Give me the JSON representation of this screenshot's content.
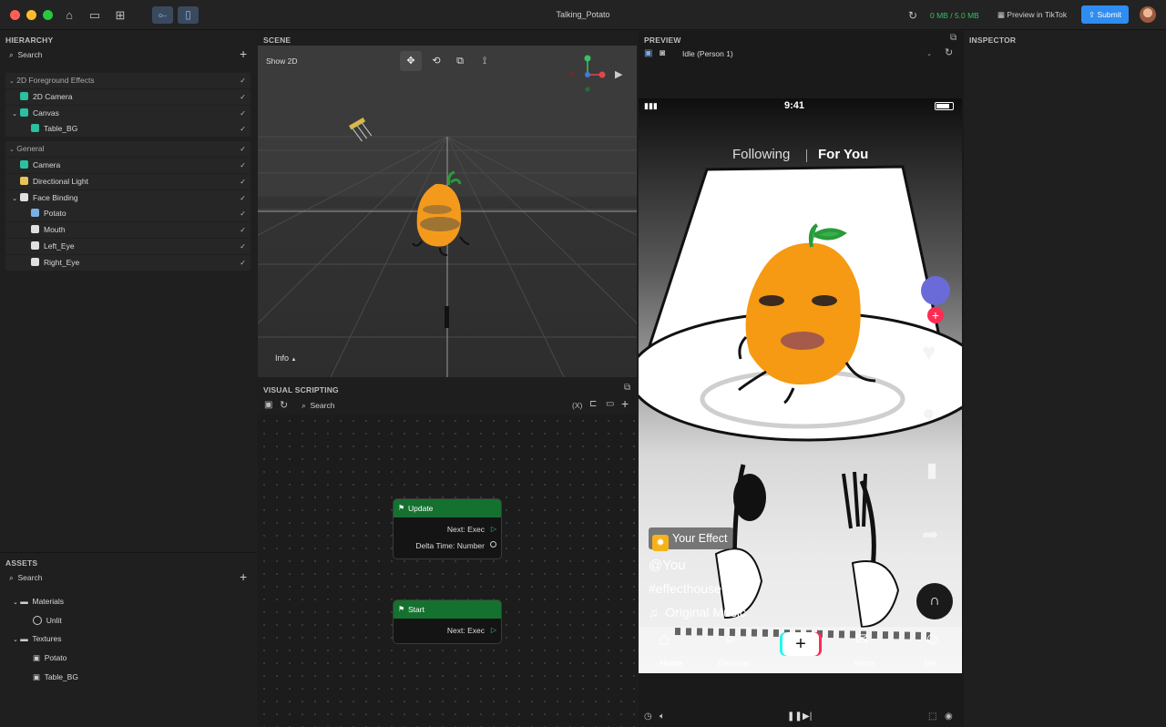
{
  "window": {
    "title": "Talking_Potato",
    "memory": "0 MB / 5.0 MB",
    "preview_btn": "Preview in TikTok",
    "submit_btn": "Submit"
  },
  "hierarchy": {
    "title": "HIERARCHY",
    "search_placeholder": "Search",
    "groups": [
      {
        "label": "2D Foreground Effects",
        "items": [
          {
            "label": "2D Camera",
            "icon": "camera-icon",
            "indent": 1
          },
          {
            "label": "Canvas",
            "icon": "canvas-icon",
            "indent": 1
          },
          {
            "label": "Table_BG",
            "icon": "image-icon",
            "indent": 2
          }
        ]
      },
      {
        "label": "General",
        "items": [
          {
            "label": "Camera",
            "icon": "camera-icon",
            "indent": 1
          },
          {
            "label": "Directional Light",
            "icon": "light-icon",
            "indent": 1
          },
          {
            "label": "Face Binding",
            "icon": "face-icon",
            "indent": 1
          },
          {
            "label": "Potato",
            "icon": "globe-icon",
            "indent": 2
          },
          {
            "label": "Mouth",
            "icon": "face-icon",
            "indent": 2
          },
          {
            "label": "Left_Eye",
            "icon": "face-icon",
            "indent": 2
          },
          {
            "label": "Right_Eye",
            "icon": "face-icon",
            "indent": 2
          }
        ]
      }
    ]
  },
  "assets": {
    "title": "ASSETS",
    "search_placeholder": "Search",
    "tree": [
      {
        "label": "Materials",
        "type": "folder",
        "indent": 1
      },
      {
        "label": "Unlit",
        "type": "material",
        "indent": 2
      },
      {
        "label": "Textures",
        "type": "folder",
        "indent": 1
      },
      {
        "label": "Potato",
        "type": "texture",
        "indent": 2
      },
      {
        "label": "Table_BG",
        "type": "texture",
        "indent": 2
      }
    ]
  },
  "scene": {
    "title": "SCENE",
    "show2d": "Show 2D",
    "info": "Info"
  },
  "visual_scripting": {
    "title": "VISUAL SCRIPTING",
    "search_placeholder": "Search",
    "var_label": "(X)",
    "update_node": {
      "title": "Update",
      "out1": "Next: Exec",
      "out2": "Delta Time: Number"
    },
    "start_node": {
      "title": "Start",
      "out1": "Next: Exec"
    }
  },
  "preview": {
    "title": "PREVIEW",
    "person": "Idle (Person 1)"
  },
  "inspector": {
    "title": "INSPECTOR"
  },
  "tiktok": {
    "time": "9:41",
    "tab_following": "Following",
    "tab_foryou": "For You",
    "effect": "Your Effect",
    "user": "@You",
    "hashtag": "#effecthouse",
    "music": "Original Music",
    "nav": [
      "Home",
      "Discover",
      "",
      "Inbox",
      "Me"
    ]
  },
  "colors": {
    "accent": "#2f8cf0",
    "node_green": "#15712f",
    "memory_green": "#33c25a"
  }
}
